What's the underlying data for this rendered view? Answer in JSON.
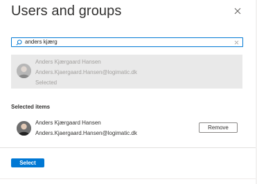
{
  "header": {
    "title": "Users and groups",
    "close_icon": "close-icon"
  },
  "search": {
    "value": "anders kjærg",
    "search_icon": "search-icon",
    "clear_icon": "clear-icon"
  },
  "result": {
    "name": "Anders Kjærgaard Hansen",
    "email": "Anders.Kjaergaard.Hansen@logimatic.dk",
    "status": "Selected"
  },
  "selected": {
    "heading": "Selected items",
    "items": [
      {
        "name": "Anders Kjærgaard Hansen",
        "email": "Anders.Kjaergaard.Hansen@logimatic.dk",
        "remove_label": "Remove"
      }
    ]
  },
  "footer": {
    "select_label": "Select"
  },
  "colors": {
    "accent": "#0078d4",
    "result_bg": "#e9e9e9"
  }
}
